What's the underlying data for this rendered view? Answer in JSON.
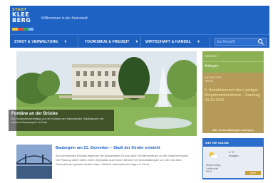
{
  "header": {
    "logo": {
      "line1": "STADT",
      "line2": "KLEE",
      "line3": "BERG",
      "colors": [
        "#f3c53a",
        "#e24a3b",
        "#3aa757",
        "#ffffff"
      ]
    },
    "tagline": "Willkommen in der Kreisstadt"
  },
  "nav": {
    "items": [
      {
        "label": "STADT & VERWALTUNG"
      },
      {
        "label": "TOURISMUS & FREIZEIT"
      },
      {
        "label": "WIRTSCHAFT & HANDEL"
      }
    ],
    "search": {
      "placeholder": "Suchbegriff"
    }
  },
  "hero": {
    "caption_title": "Fontäne an der Brücke",
    "caption_text": "Ein Sommernachmittag vor der Kulisse des historischen Stadthauses mit seinem Wasserspiel im Park"
  },
  "sidebar": {
    "box1_label": "SERVICE",
    "box1_value": "Anliegen",
    "event_label": "AKTUELLES",
    "event_date": "Termin",
    "event_title": "5. Benefizkonzert des Leistiger Bürgermeisterchores – Sonntag 20.10.2012",
    "event_more": "Alle Veranstaltungen anzeigen",
    "weather_title": "WETTER ONLINE",
    "weather_temp": "4 °C\nmorgen",
    "weather_detail": "Niederschlag\nLuftfeuchte\nWind",
    "weather_button": "mehr"
  },
  "news": {
    "title": "Baubeginn am 21. Dezember – Stadt der Kinder entsteht",
    "text": "Am kommenden Montag beginnen die Bauarbeiten für das neue Familienzentrum an der Uferpromenade. Die Planung sieht neben einem Spielplatz auch einen Bereich für Veranstaltungen vor, der von allen Generationen genutzt werden kann. Weitere Informationen folgen in Kürze."
  }
}
